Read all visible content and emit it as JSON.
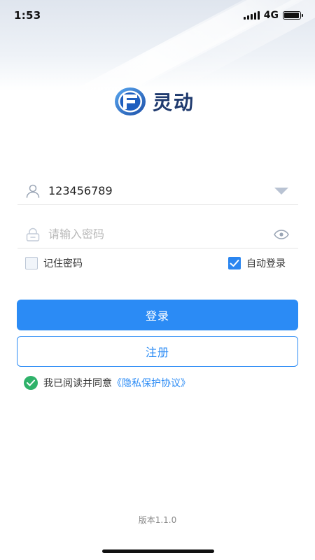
{
  "status_bar": {
    "time": "1:53",
    "network": "4G",
    "battery_level": 0.95
  },
  "brand": {
    "name": "灵动",
    "logo_icon": "lingdong-logo-icon",
    "primary_color": "#2b8bf5",
    "logo_color": "#1f3a6e"
  },
  "form": {
    "username": {
      "value": "123456789",
      "icon": "user-icon",
      "trailing_icon": "dropdown-triangle-icon"
    },
    "password": {
      "placeholder": "请输入密码",
      "value": "",
      "icon": "lock-icon",
      "trailing_icon": "eye-icon"
    },
    "remember_password": {
      "label": "记住密码",
      "checked": false
    },
    "auto_login": {
      "label": "自动登录",
      "checked": true
    }
  },
  "buttons": {
    "login_label": "登录",
    "register_label": "注册"
  },
  "agreement": {
    "prefix": "我已阅读并同意",
    "link": "《隐私保护协议》",
    "checked": true,
    "check_color": "#2fb26a"
  },
  "footer": {
    "version": "版本1.1.0"
  }
}
